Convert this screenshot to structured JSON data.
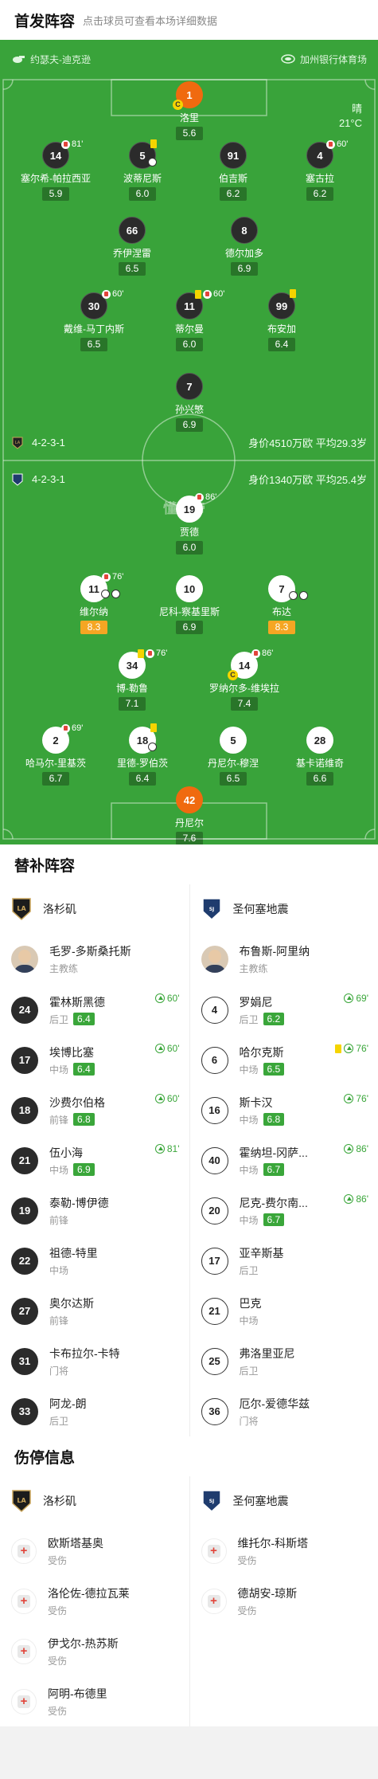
{
  "lineup": {
    "title": "首发阵容",
    "subtitle": "点击球员可查看本场详细数据"
  },
  "pitch": {
    "referee": "约瑟夫-迪克逊",
    "venue": "加州银行体育场",
    "weather": "晴",
    "temperature": "21°C",
    "watermark": "懂球帝",
    "home_formation": "4-2-3-1",
    "home_value": "身价4510万欧 平均29.3岁",
    "away_formation": "4-2-3-1",
    "away_value": "身价1340万欧 平均25.4岁"
  },
  "home_players": [
    {
      "num": "1",
      "name": "洛里",
      "rating": "5.6"
    },
    {
      "num": "14",
      "name": "塞尔希-帕拉西亚",
      "rating": "5.9",
      "ev": "81'"
    },
    {
      "num": "5",
      "name": "波蒂尼斯",
      "rating": "6.0"
    },
    {
      "num": "91",
      "name": "伯吉斯",
      "rating": "6.2"
    },
    {
      "num": "4",
      "name": "塞古拉",
      "rating": "6.2",
      "ev": "60'"
    },
    {
      "num": "66",
      "name": "乔伊涅雷",
      "rating": "6.5"
    },
    {
      "num": "8",
      "name": "德尔加多",
      "rating": "6.9"
    },
    {
      "num": "30",
      "name": "戴维-马丁内斯",
      "rating": "6.5",
      "ev": "60'"
    },
    {
      "num": "11",
      "name": "蒂尔曼",
      "rating": "6.0",
      "ev": "60'"
    },
    {
      "num": "99",
      "name": "布安加",
      "rating": "6.4"
    },
    {
      "num": "7",
      "name": "孙兴慜",
      "rating": "6.9"
    }
  ],
  "away_players": [
    {
      "num": "19",
      "name": "贾德",
      "rating": "6.0",
      "ev": "86'"
    },
    {
      "num": "11",
      "name": "维尔纳",
      "rating": "8.3",
      "ev": "76'"
    },
    {
      "num": "10",
      "name": "尼科-察基里斯",
      "rating": "6.9"
    },
    {
      "num": "7",
      "name": "布达",
      "rating": "8.3"
    },
    {
      "num": "34",
      "name": "博-勒鲁",
      "rating": "7.1",
      "ev": "76'"
    },
    {
      "num": "14",
      "name": "罗纳尔多-维埃拉",
      "rating": "7.4",
      "ev": "86'"
    },
    {
      "num": "2",
      "name": "哈马尔-里基茨",
      "rating": "6.7",
      "ev": "69'"
    },
    {
      "num": "18",
      "name": "里德-罗伯茨",
      "rating": "6.4"
    },
    {
      "num": "5",
      "name": "丹尼尔-穆涅",
      "rating": "6.5"
    },
    {
      "num": "28",
      "name": "基卡诺维奇",
      "rating": "6.6"
    },
    {
      "num": "42",
      "name": "丹尼尔",
      "rating": "7.6"
    }
  ],
  "subs": {
    "title": "替补阵容",
    "home_team": "洛杉矶",
    "away_team": "圣何塞地震",
    "home_coach": {
      "name": "毛罗-多斯桑托斯",
      "role": "主教练"
    },
    "away_coach": {
      "name": "布鲁斯-阿里纳",
      "role": "主教练"
    },
    "home": [
      {
        "num": "24",
        "name": "霍林斯黑德",
        "pos": "后卫",
        "rating": "6.4",
        "min": "60'"
      },
      {
        "num": "17",
        "name": "埃博比塞",
        "pos": "中场",
        "rating": "6.4",
        "min": "60'"
      },
      {
        "num": "18",
        "name": "沙费尔伯格",
        "pos": "前锋",
        "rating": "6.8",
        "min": "60'"
      },
      {
        "num": "21",
        "name": "伍小海",
        "pos": "中场",
        "rating": "6.9",
        "min": "81'"
      },
      {
        "num": "19",
        "name": "泰勒-博伊德",
        "pos": "前锋"
      },
      {
        "num": "22",
        "name": "祖德-特里",
        "pos": "中场"
      },
      {
        "num": "27",
        "name": "奥尔达斯",
        "pos": "前锋"
      },
      {
        "num": "31",
        "name": "卡布拉尔-卡特",
        "pos": "门将"
      },
      {
        "num": "33",
        "name": "阿龙-朗",
        "pos": "后卫"
      }
    ],
    "away": [
      {
        "num": "4",
        "name": "罗娟尼",
        "pos": "后卫",
        "rating": "6.2",
        "min": "69'"
      },
      {
        "num": "6",
        "name": "哈尔克斯",
        "pos": "中场",
        "rating": "6.5",
        "min": "76'"
      },
      {
        "num": "16",
        "name": "斯卡汉",
        "pos": "中场",
        "rating": "6.8",
        "min": "76'"
      },
      {
        "num": "40",
        "name": "霍纳坦-冈萨...",
        "pos": "中场",
        "rating": "6.7",
        "min": "86'"
      },
      {
        "num": "20",
        "name": "尼克-费尔南...",
        "pos": "中场",
        "rating": "6.7",
        "min": "86'"
      },
      {
        "num": "17",
        "name": "亚辛斯基",
        "pos": "后卫"
      },
      {
        "num": "21",
        "name": "巴克",
        "pos": "中场"
      },
      {
        "num": "25",
        "name": "弗洛里亚尼",
        "pos": "后卫"
      },
      {
        "num": "36",
        "name": "厄尔-爱德华兹",
        "pos": "门将"
      }
    ]
  },
  "injury": {
    "title": "伤停信息",
    "home": [
      {
        "name": "欧斯塔基奥",
        "status": "受伤"
      },
      {
        "name": "洛伦佐-德拉瓦莱",
        "status": "受伤"
      },
      {
        "name": "伊戈尔-热苏斯",
        "status": "受伤"
      },
      {
        "name": "阿明-布德里",
        "status": "受伤"
      }
    ],
    "away": [
      {
        "name": "维托尔-科斯塔",
        "status": "受伤"
      },
      {
        "name": "德胡安-琼斯",
        "status": "受伤"
      }
    ]
  },
  "colors": {
    "pitch": "#39a33a",
    "accent": "#f06a0f",
    "rating_green": "#3aa63a",
    "best": "#f5a623"
  }
}
